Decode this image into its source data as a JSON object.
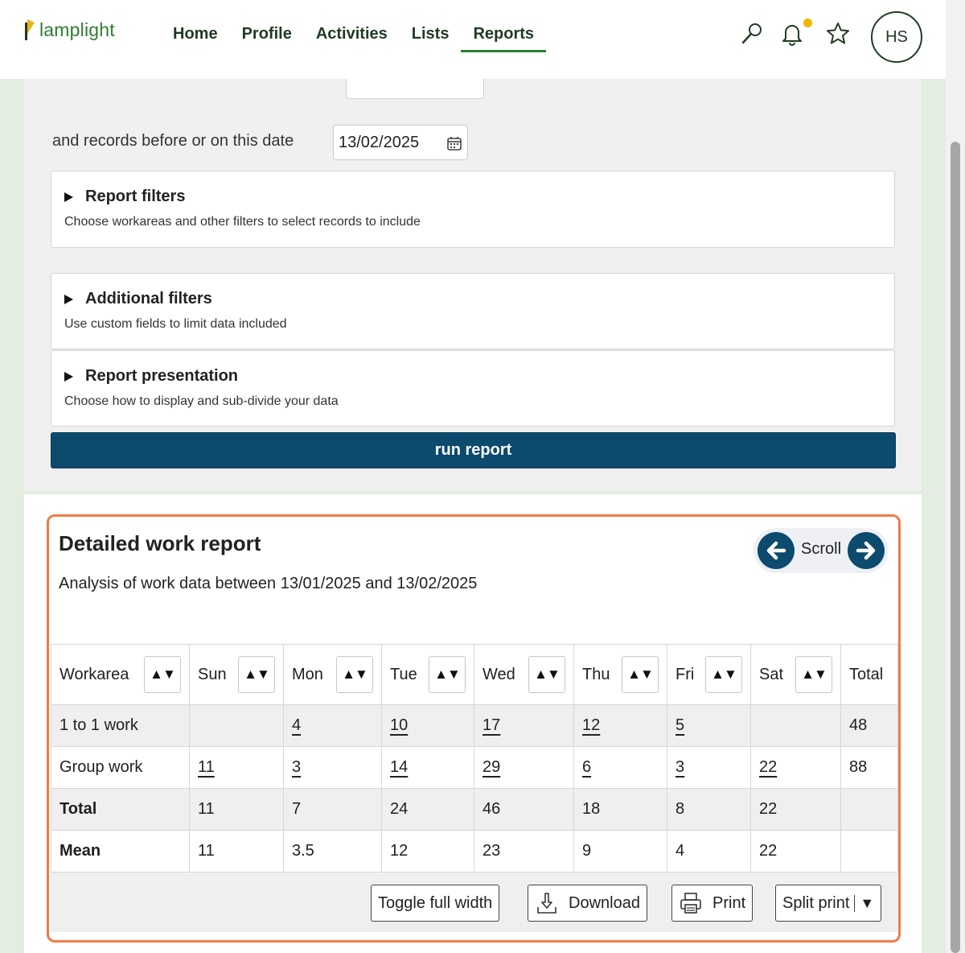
{
  "app": {
    "logo_text": "lamplight"
  },
  "nav": {
    "items": [
      "Home",
      "Profile",
      "Activities",
      "Lists",
      "Reports"
    ],
    "active": "Reports",
    "user_initials": "HS"
  },
  "form": {
    "date_label": "and records before or on this date",
    "date_value": "13/02/2025",
    "panels": [
      {
        "title": "Report filters",
        "desc": "Choose workareas and other filters to select records to include"
      },
      {
        "title": "Additional filters",
        "desc": "Use custom fields to limit data included"
      },
      {
        "title": "Report presentation",
        "desc": "Choose how to display and sub-divide your data"
      }
    ],
    "run_label": "run report"
  },
  "report": {
    "title": "Detailed work report",
    "subtitle": "Analysis of work data between 13/01/2025 and 13/02/2025",
    "scroll_label": "Scroll",
    "sort_glyph": "▲▼",
    "columns": [
      "Workarea",
      "Sun",
      "Mon",
      "Tue",
      "Wed",
      "Thu",
      "Fri",
      "Sat",
      "Total"
    ],
    "rows": [
      {
        "label": "1 to 1 work",
        "cells": [
          "",
          "4",
          "10",
          "17",
          "12",
          "5",
          ""
        ],
        "total": "48"
      },
      {
        "label": "Group work",
        "cells": [
          "11",
          "3",
          "14",
          "29",
          "6",
          "3",
          "22"
        ],
        "total": "88"
      },
      {
        "label": "Total",
        "cells": [
          "11",
          "7",
          "24",
          "46",
          "18",
          "8",
          "22"
        ],
        "total": ""
      },
      {
        "label": "Mean",
        "cells": [
          "11",
          "3.5",
          "12",
          "23",
          "9",
          "4",
          "22"
        ],
        "total": ""
      }
    ],
    "toolbar": {
      "toggle_label": "Toggle full width",
      "download_label": "Download",
      "print_label": "Print",
      "split_label": "Split print",
      "split_caret": "▼"
    }
  },
  "colors": {
    "brand_green": "#2e7d32",
    "primary_blue": "#0c4a6e",
    "highlight_orange": "#ef7d45",
    "notification_dot": "#f5b400"
  }
}
